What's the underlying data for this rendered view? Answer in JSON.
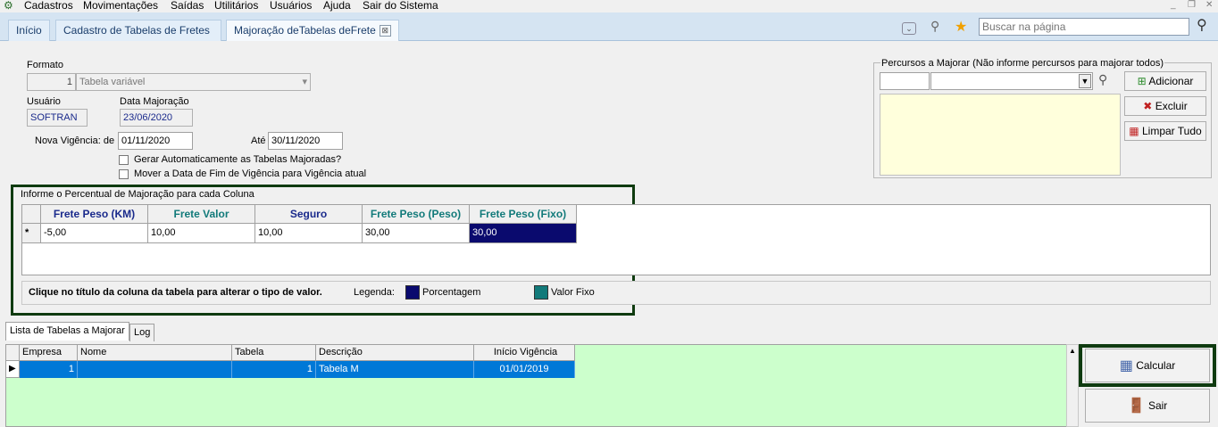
{
  "menu": {
    "items": [
      "Cadastros",
      "Movimentações",
      "Saídas",
      "Utilitários",
      "Usuários",
      "Ajuda",
      "Sair do Sistema"
    ]
  },
  "tabs": [
    {
      "label": "Início"
    },
    {
      "label": "Cadastro de Tabelas de Fretes"
    },
    {
      "label": "Majoração deTabelas deFrete",
      "close": "⊠"
    }
  ],
  "search": {
    "placeholder": "Buscar na página"
  },
  "form": {
    "formato_label": "Formato",
    "formato_code": "1",
    "formato_value": "Tabela variável",
    "usuario_label": "Usuário",
    "usuario_value": "SOFTRAN",
    "data_label": "Data Majoração",
    "data_value": "23/06/2020",
    "vigencia_label": "Nova Vigência: de",
    "vigencia_de": "01/11/2020",
    "ate_label": "Até",
    "vigencia_ate": "30/11/2020",
    "check1": "Gerar Automaticamente as Tabelas Majoradas?",
    "check2": "Mover a Data de Fim de Vigência para Vigência atual"
  },
  "percentual": {
    "title": "Informe o Percentual de Majoração para cada Coluna",
    "row_marker": "*",
    "columns": [
      {
        "label": "Frete Peso (KM)",
        "value": "-5,00",
        "color": "#1a2a8c"
      },
      {
        "label": "Frete Valor",
        "value": "10,00",
        "color": "#127a7a"
      },
      {
        "label": "Seguro",
        "value": "10,00",
        "color": "#1a2a8c"
      },
      {
        "label": "Frete Peso (Peso)",
        "value": "30,00",
        "color": "#127a7a"
      },
      {
        "label": "Frete Peso (Fixo)",
        "value": "30,00",
        "color": "#127a7a"
      }
    ],
    "hint": "Clique no título da coluna da tabela para alterar o tipo de valor.",
    "legend_label": "Legenda:",
    "legend": [
      {
        "label": "Porcentagem",
        "color": "#0a0a6e"
      },
      {
        "label": "Valor Fixo",
        "color": "#127a7a"
      }
    ]
  },
  "percursos": {
    "title": "Percursos a Majorar (Não informe percursos para majorar todos)",
    "add": "Adicionar",
    "remove": "Excluir",
    "clear": "Limpar Tudo"
  },
  "bottom_tabs": [
    {
      "label": "Lista de Tabelas a Majorar"
    },
    {
      "label": "Log"
    }
  ],
  "list": {
    "headers": [
      "Empresa",
      "Nome",
      "Tabela",
      "Descrição",
      "Início Vigência"
    ],
    "rows": [
      {
        "empresa": "1",
        "nome": "",
        "tabela": "1",
        "descricao": "Tabela M",
        "inicio": "01/01/2019"
      }
    ]
  },
  "actions": {
    "calcular": "Calcular",
    "sair": "Sair"
  },
  "colors": {
    "selection": "#0078d7",
    "list_bg": "#ccffcc",
    "highlight_frame": "#0f3b10"
  }
}
